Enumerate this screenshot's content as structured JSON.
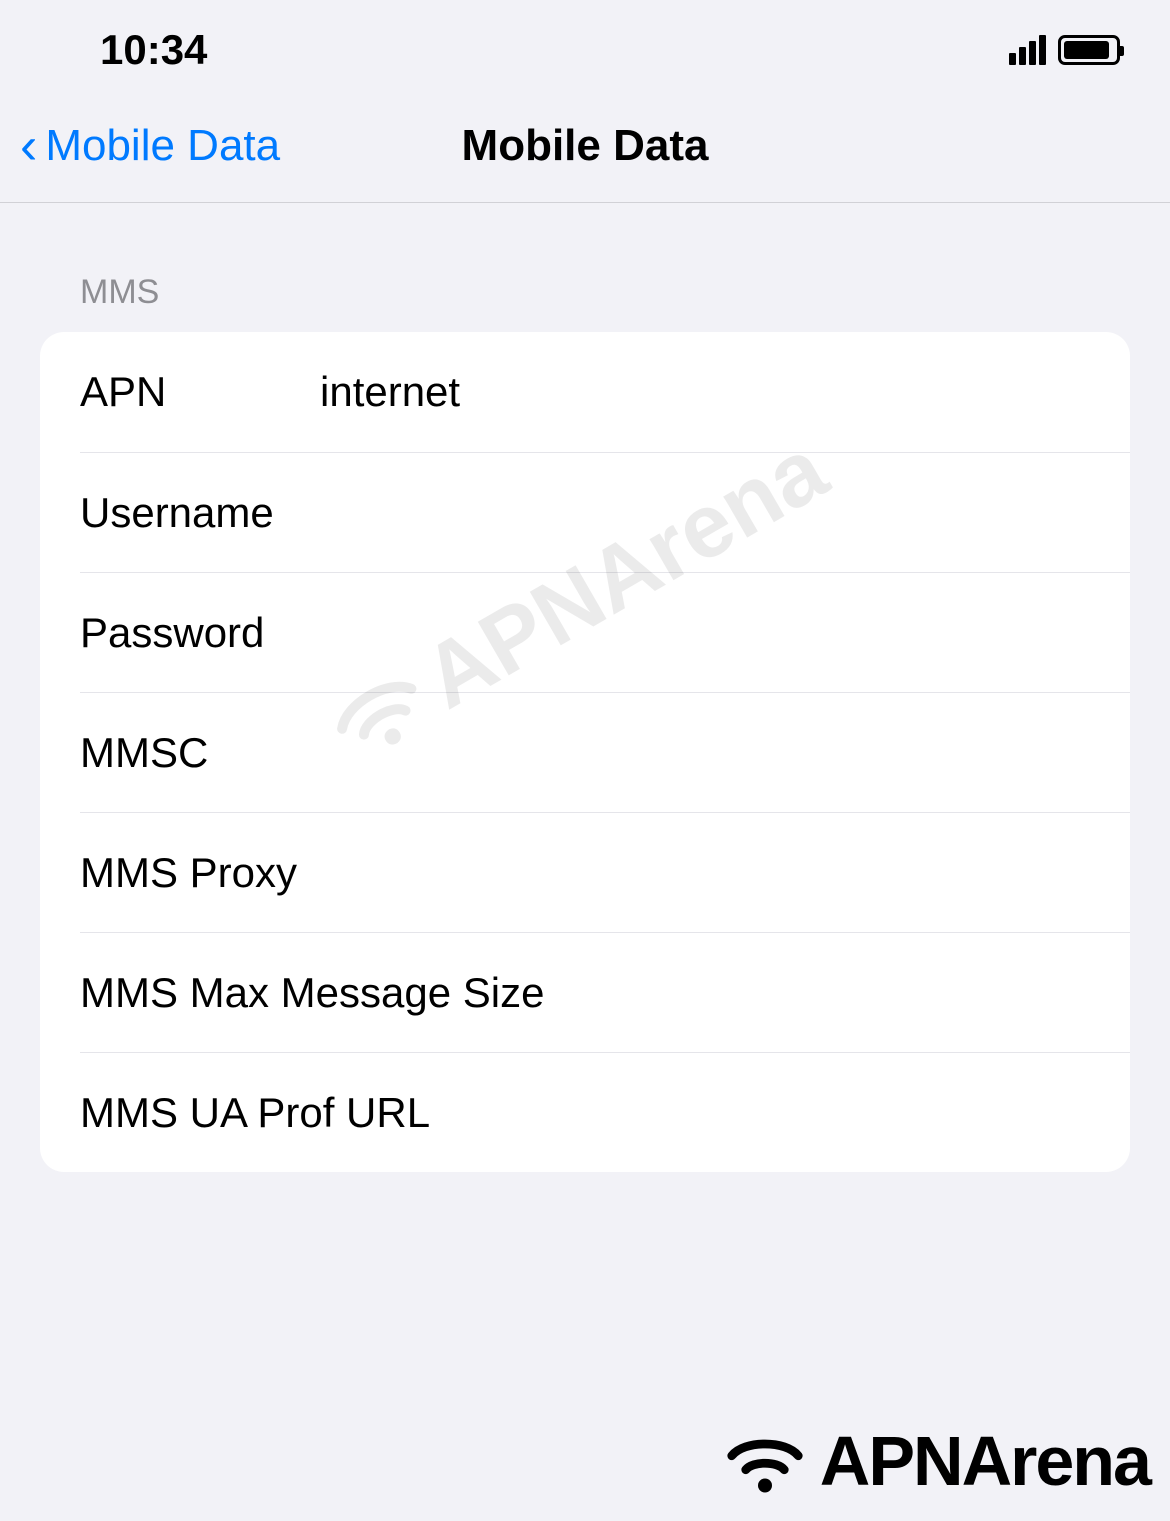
{
  "statusBar": {
    "time": "10:34"
  },
  "navBar": {
    "backLabel": "Mobile Data",
    "title": "Mobile Data"
  },
  "section": {
    "header": "MMS",
    "rows": [
      {
        "label": "APN",
        "value": "internet"
      },
      {
        "label": "Username",
        "value": ""
      },
      {
        "label": "Password",
        "value": ""
      },
      {
        "label": "MMSC",
        "value": ""
      },
      {
        "label": "MMS Proxy",
        "value": ""
      },
      {
        "label": "MMS Max Message Size",
        "value": ""
      },
      {
        "label": "MMS UA Prof URL",
        "value": ""
      }
    ]
  },
  "watermark": {
    "text": "APNArena"
  }
}
